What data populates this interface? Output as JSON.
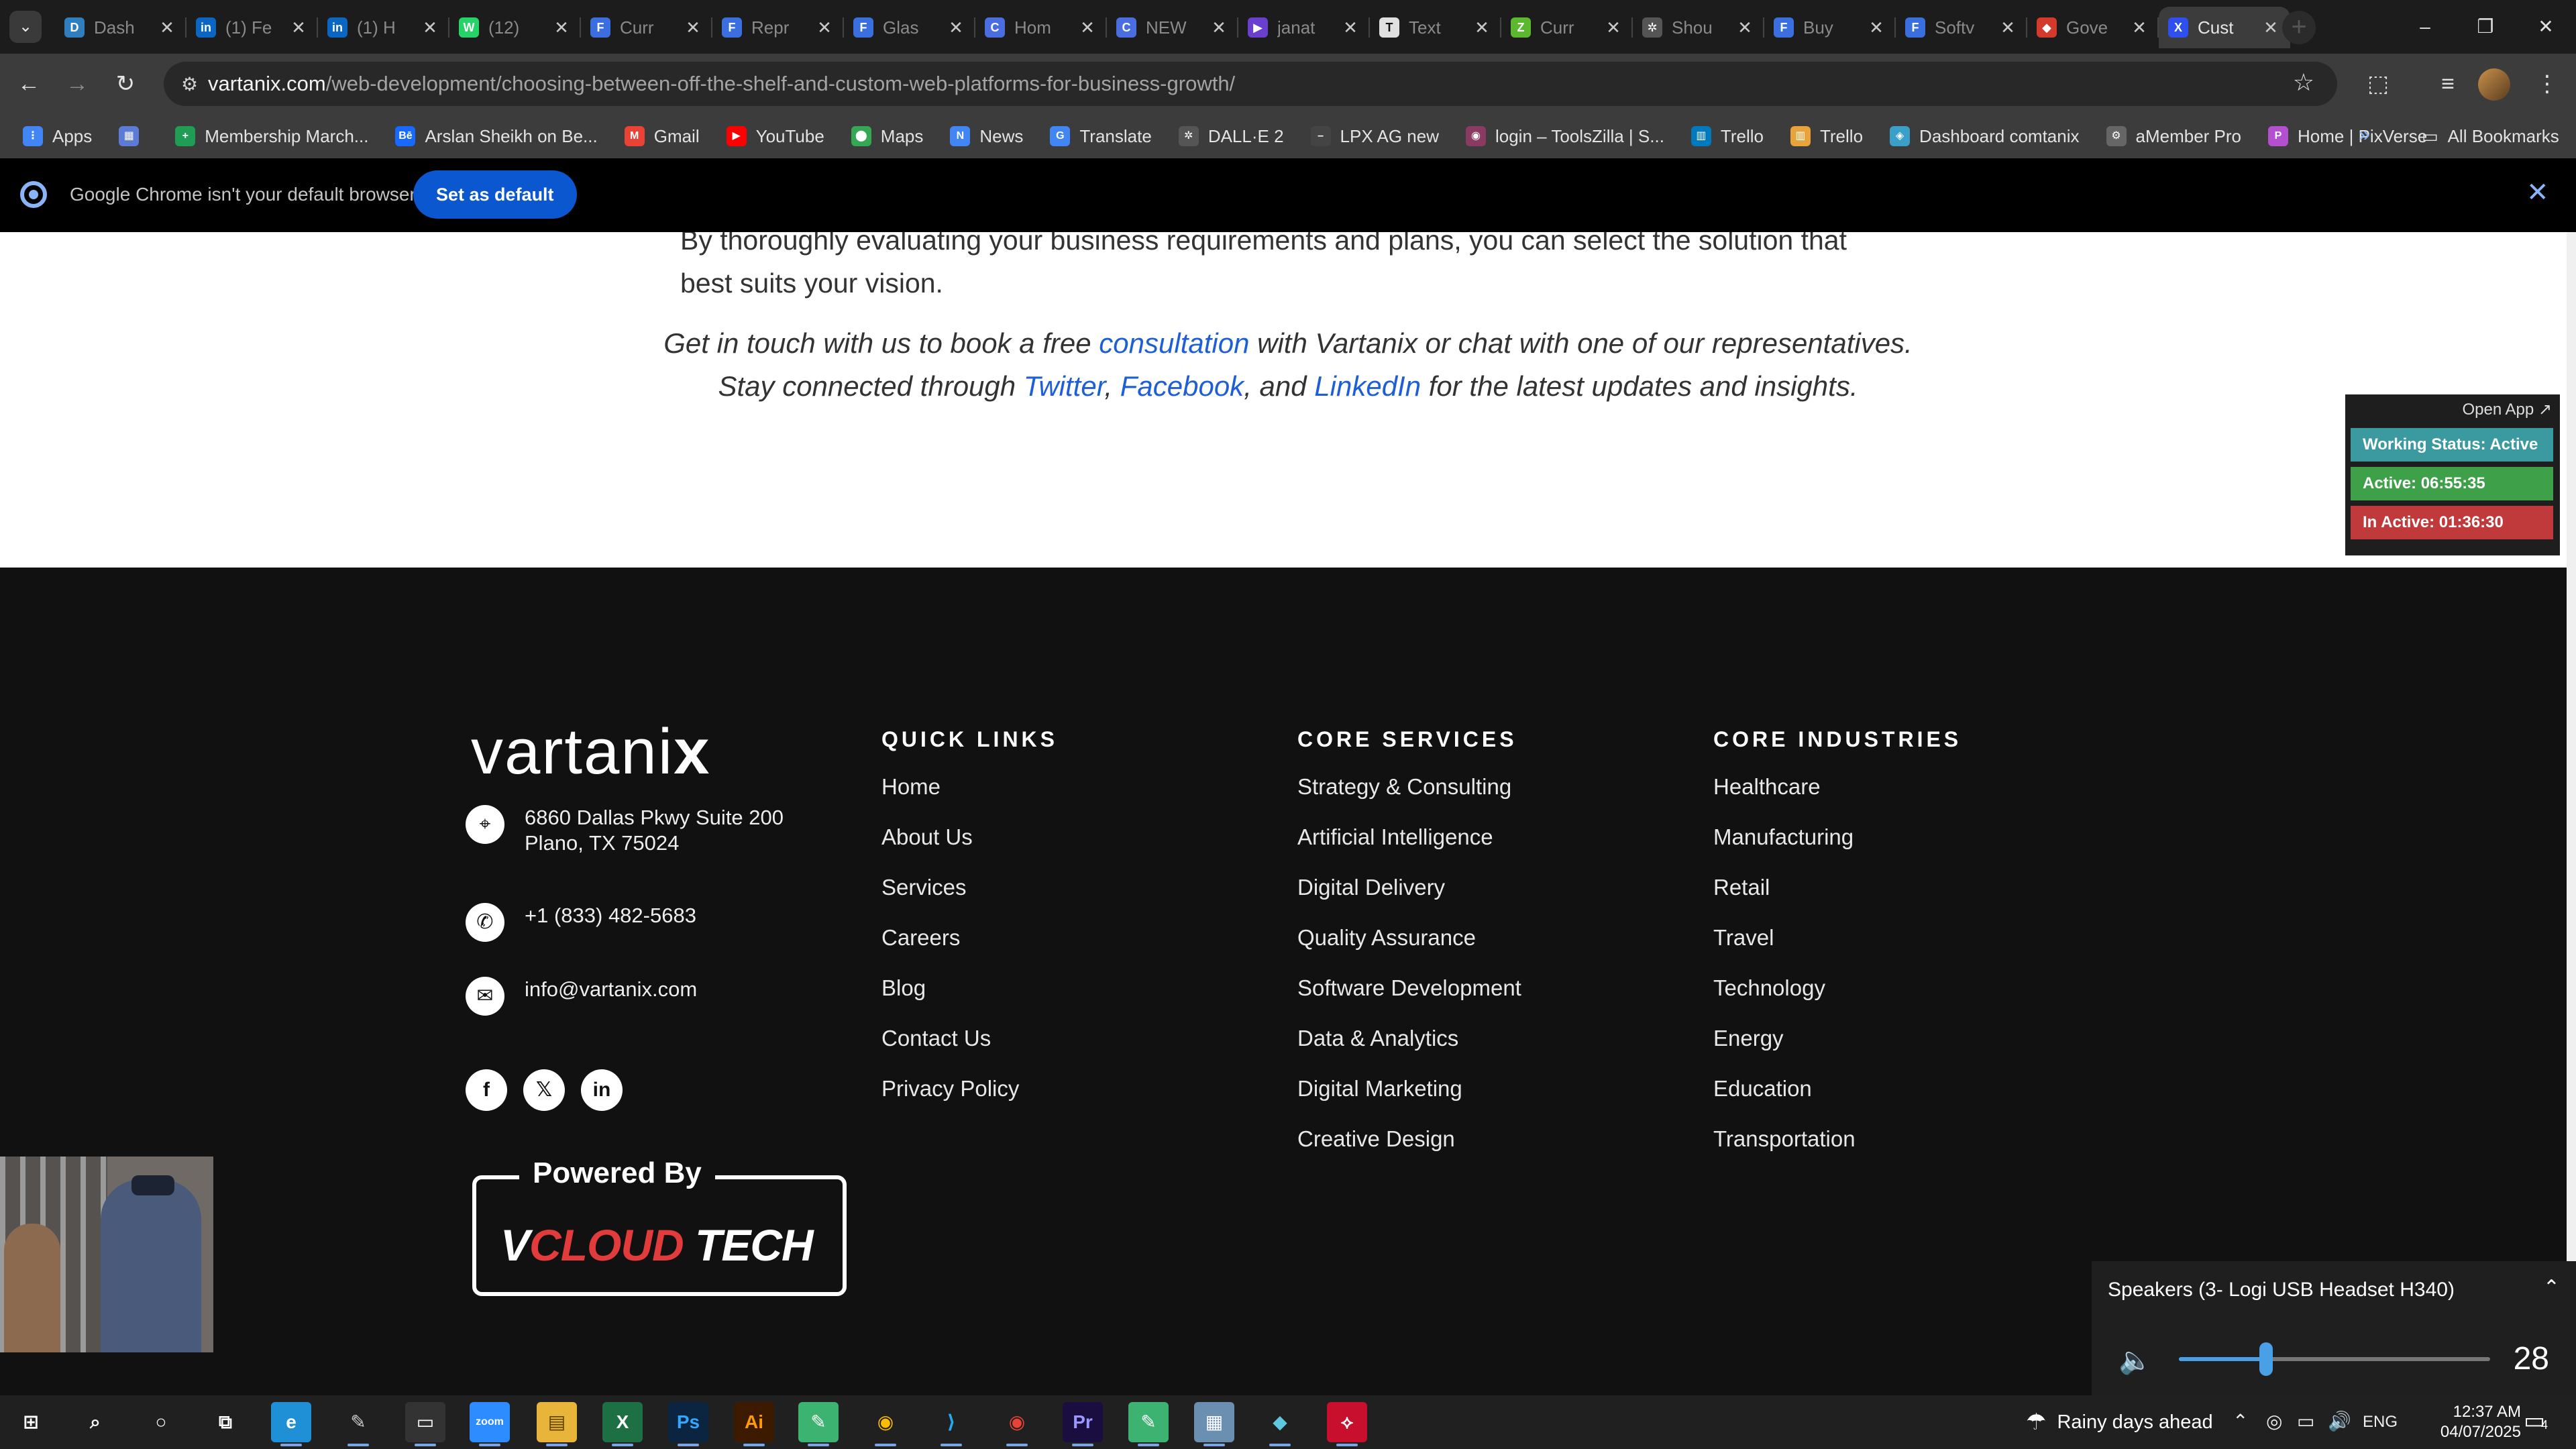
{
  "tabs": [
    {
      "title": "Dash",
      "icon": "dashboard-icon",
      "color": "#2f7fbf",
      "glyph": "D"
    },
    {
      "title": "(1) Fe",
      "icon": "linkedin-icon",
      "color": "#0a66c2",
      "glyph": "in"
    },
    {
      "title": "(1) H",
      "icon": "linkedin-icon",
      "color": "#0a66c2",
      "glyph": "in"
    },
    {
      "title": "(12)",
      "icon": "whatsapp-icon",
      "color": "#25d366",
      "glyph": "W"
    },
    {
      "title": "Curr",
      "icon": "docs-icon",
      "color": "#3b6fe0",
      "glyph": "F"
    },
    {
      "title": "Repr",
      "icon": "docs-icon",
      "color": "#3b6fe0",
      "glyph": "F"
    },
    {
      "title": "Glas",
      "icon": "docs-icon",
      "color": "#3b6fe0",
      "glyph": "F"
    },
    {
      "title": "Hom",
      "icon": "c-logo-icon",
      "color": "#4a6ee0",
      "glyph": "C"
    },
    {
      "title": "NEW",
      "icon": "c-logo-icon",
      "color": "#4a6ee0",
      "glyph": "C"
    },
    {
      "title": "janat",
      "icon": "video-icon",
      "color": "#6a3fd0",
      "glyph": "▶"
    },
    {
      "title": "Text",
      "icon": "text-icon",
      "color": "#e0e0e0",
      "glyph": "T"
    },
    {
      "title": "Curr",
      "icon": "leaf-icon",
      "color": "#5cb82e",
      "glyph": "Z"
    },
    {
      "title": "Shou",
      "icon": "openai-icon",
      "color": "#555555",
      "glyph": "✲"
    },
    {
      "title": "Buy",
      "icon": "docs-icon",
      "color": "#3b6fe0",
      "glyph": "F"
    },
    {
      "title": "Softv",
      "icon": "docs-icon",
      "color": "#3b6fe0",
      "glyph": "F"
    },
    {
      "title": "Gove",
      "icon": "ruby-icon",
      "color": "#d33a2c",
      "glyph": "◆"
    },
    {
      "title": "Cust",
      "icon": "vartanix-icon",
      "color": "#2f4ff0",
      "glyph": "X",
      "active": true
    }
  ],
  "url": {
    "host": "vartanix.com",
    "path": "/web-development/choosing-between-off-the-shelf-and-custom-web-platforms-for-business-growth/"
  },
  "bookmarks": [
    {
      "label": "Apps",
      "icon": "apps-grid-icon",
      "color": "#4285f4",
      "glyph": "⋮"
    },
    {
      "label": "",
      "icon": "grid-icon",
      "color": "#5b7bd6",
      "glyph": "▦"
    },
    {
      "label": "Membership March...",
      "icon": "sheets-icon",
      "color": "#1f9d55",
      "glyph": "+"
    },
    {
      "label": "Arslan Sheikh on Be...",
      "icon": "behance-icon",
      "color": "#1769ff",
      "glyph": "Bē"
    },
    {
      "label": "Gmail",
      "icon": "gmail-icon",
      "color": "#ea4335",
      "glyph": "M"
    },
    {
      "label": "YouTube",
      "icon": "youtube-icon",
      "color": "#ff0000",
      "glyph": "▶"
    },
    {
      "label": "Maps",
      "icon": "maps-icon",
      "color": "#34a853",
      "glyph": "⬤"
    },
    {
      "label": "News",
      "icon": "news-icon",
      "color": "#4285f4",
      "glyph": "N"
    },
    {
      "label": "Translate",
      "icon": "translate-icon",
      "color": "#4285f4",
      "glyph": "G"
    },
    {
      "label": "DALL·E 2",
      "icon": "openai-icon",
      "color": "#555555",
      "glyph": "✲"
    },
    {
      "label": "LPX AG new",
      "icon": "lpx-icon",
      "color": "#444444",
      "glyph": "–"
    },
    {
      "label": "login – ToolsZilla | S...",
      "icon": "toolszilla-icon",
      "color": "#8b3a62",
      "glyph": "◉"
    },
    {
      "label": "Trello",
      "icon": "trello-icon",
      "color": "#0079bf",
      "glyph": "▥"
    },
    {
      "label": "Trello",
      "icon": "trello-icon",
      "color": "#e8a33a",
      "glyph": "▥"
    },
    {
      "label": "Dashboard comtanix",
      "icon": "comtanix-icon",
      "color": "#3aa0c8",
      "glyph": "◈"
    },
    {
      "label": "aMember Pro",
      "icon": "amember-icon",
      "color": "#666666",
      "glyph": "⚙"
    },
    {
      "label": "Home | PixVerse",
      "icon": "pixverse-icon",
      "color": "#b44fd0",
      "glyph": "P"
    }
  ],
  "bookmarks_all": "All Bookmarks",
  "infobar": {
    "message": "Google Chrome isn't your default browser",
    "button": "Set as default"
  },
  "article": {
    "paragraph": "By thoroughly evaluating your business requirements and plans, you can select the solution that best suits your vision.",
    "cta": {
      "t1": "Get in touch with us to book a free ",
      "l1": "consultation",
      "t2": " with Vartanix or chat with one of our representatives.",
      "t3": "Stay connected through ",
      "l2": "Twitter",
      "t4": ", ",
      "l3": "Facebook",
      "t5": ", and ",
      "l4": "LinkedIn",
      "t6": " for the latest updates and insights."
    }
  },
  "footer": {
    "logo": {
      "text": "vartani",
      "mark": "x"
    },
    "address": "6860 Dallas Pkwy Suite 200 Plano, TX 75024",
    "phone": "+1 (833) 482-5683",
    "email": "info@vartanix.com",
    "social": [
      "facebook",
      "x",
      "linkedin"
    ],
    "powered": {
      "label": "Powered By",
      "v": "V",
      "cloud": "CLOUD",
      "tech": " TECH"
    },
    "quick_links": {
      "heading": "QUICK LINKS",
      "items": [
        "Home",
        "About Us",
        "Services",
        "Careers",
        "Blog",
        "Contact Us",
        "Privacy Policy"
      ]
    },
    "core_services": {
      "heading": "CORE SERVICES",
      "items": [
        "Strategy & Consulting",
        "Artificial Intelligence",
        "Digital Delivery",
        "Quality Assurance",
        "Software Development",
        "Data & Analytics",
        "Digital Marketing",
        "Creative Design"
      ]
    },
    "core_industries": {
      "heading": "CORE INDUSTRIES",
      "items": [
        "Healthcare",
        "Manufacturing",
        "Retail",
        "Travel",
        "Technology",
        "Energy",
        "Education",
        "Transportation"
      ]
    }
  },
  "widget": {
    "open_app": "Open App ↗",
    "working": "Working Status: Active",
    "active": "Active: 06:55:35",
    "inactive": "In Active: 01:36:30",
    "colors": {
      "working": "#3a9aa0",
      "active": "#3fa04a",
      "inactive": "#c0393b"
    }
  },
  "volume": {
    "device": "Speakers (3- Logi USB Headset H340)",
    "level": 28
  },
  "taskbar": {
    "apps": [
      {
        "name": "start-icon",
        "glyph": "⊞",
        "color": "#202020",
        "fg": "#ffffff"
      },
      {
        "name": "search-icon",
        "glyph": "⌕",
        "color": "#202020",
        "fg": "#ffffff"
      },
      {
        "name": "cortana-icon",
        "glyph": "○",
        "color": "#202020",
        "fg": "#ffffff"
      },
      {
        "name": "task-view-icon",
        "glyph": "⧉",
        "color": "#202020",
        "fg": "#ffffff"
      },
      {
        "name": "edge-icon",
        "glyph": "e",
        "color": "#1f8fd6",
        "fg": "#ffffff"
      },
      {
        "name": "pen-icon",
        "glyph": "✎",
        "color": "#202020",
        "fg": "#cccccc"
      },
      {
        "name": "terminal-icon",
        "glyph": "▭",
        "color": "#333333",
        "fg": "#ffffff"
      },
      {
        "name": "zoom-icon",
        "glyph": "zoom",
        "color": "#2d8cff",
        "fg": "#ffffff"
      },
      {
        "name": "file-explorer-icon",
        "glyph": "▤",
        "color": "#e8b43a",
        "fg": "#5a3e00"
      },
      {
        "name": "excel-icon",
        "glyph": "X",
        "color": "#1d7044",
        "fg": "#ffffff"
      },
      {
        "name": "photoshop-icon",
        "glyph": "Ps",
        "color": "#0b2540",
        "fg": "#31a8ff"
      },
      {
        "name": "illustrator-icon",
        "glyph": "Ai",
        "color": "#3b1a00",
        "fg": "#ff9a00"
      },
      {
        "name": "greenshot-icon",
        "glyph": "✎",
        "color": "#3cb371",
        "fg": "#ffffff"
      },
      {
        "name": "chrome-icon",
        "glyph": "◉",
        "color": "#202020",
        "fg": "#fbbc04"
      },
      {
        "name": "vscode-icon",
        "glyph": "⟩",
        "color": "#202020",
        "fg": "#23a9f2"
      },
      {
        "name": "chrome-alt-icon",
        "glyph": "◉",
        "color": "#202020",
        "fg": "#ea4335"
      },
      {
        "name": "premiere-icon",
        "glyph": "Pr",
        "color": "#1a0d40",
        "fg": "#9999ff"
      },
      {
        "name": "greenshot-alt-icon",
        "glyph": "✎",
        "color": "#3cb371",
        "fg": "#ffffff"
      },
      {
        "name": "calculator-icon",
        "glyph": "▦",
        "color": "#6a8fb0",
        "fg": "#ffffff"
      },
      {
        "name": "app-diamond-icon",
        "glyph": "◆",
        "color": "#202020",
        "fg": "#5fc8e0"
      },
      {
        "name": "acrobat-icon",
        "glyph": "⟡",
        "color": "#c8102e",
        "fg": "#ffffff"
      }
    ],
    "weather": "Rainy days ahead",
    "lang": "ENG",
    "time": "12:37 AM",
    "date": "04/07/2025",
    "notifications": "4"
  }
}
